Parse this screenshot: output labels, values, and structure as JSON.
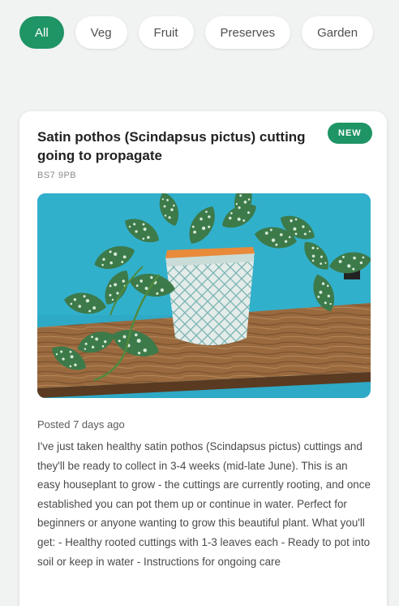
{
  "filters": [
    {
      "label": "All",
      "active": true
    },
    {
      "label": "Veg",
      "active": false
    },
    {
      "label": "Fruit",
      "active": false
    },
    {
      "label": "Preserves",
      "active": false
    },
    {
      "label": "Garden",
      "active": false
    }
  ],
  "listing": {
    "title_line1": "Satin pothos (Scindapsus pictus) cutting",
    "title_line2": "going to propagate",
    "badge": "NEW",
    "postcode": "BS7 9PB",
    "posted": "Posted 7 days ago",
    "description": "I've just taken healthy satin pothos (Scindapsus pictus) cuttings and they'll be ready to collect in 3-4 weeks (mid-late June). This is an easy houseplant to grow - the cuttings are currently rooting, and once established you can pot them up or continue in water. Perfect for beginners or anyone wanting to grow this beautiful plant. What you'll get: - Healthy rooted cuttings with 1-3 leaves each - Ready to pot into soil or keep in water - Instructions for ongoing care"
  },
  "colors": {
    "accent": "#1f9464",
    "background": "#f1f3f2",
    "card": "#ffffff"
  }
}
